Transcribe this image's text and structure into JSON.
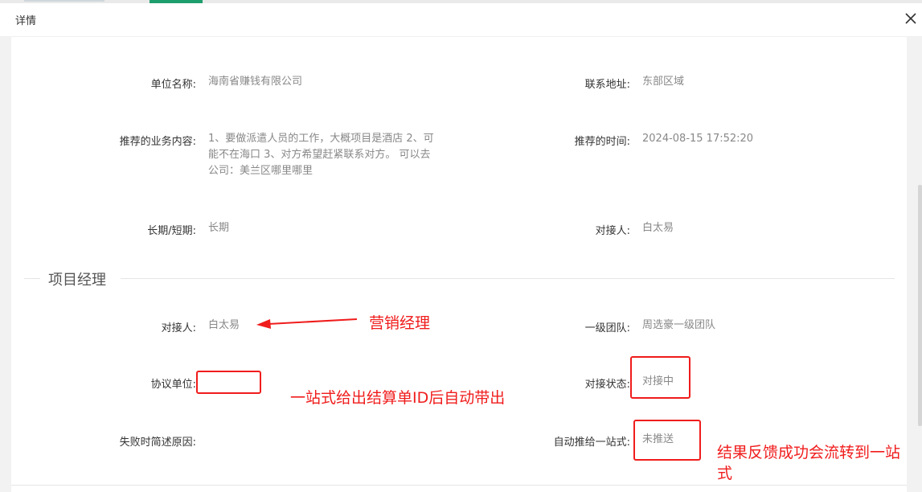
{
  "dialog": {
    "title": "详情"
  },
  "info": {
    "unit_label": "单位名称:",
    "unit_value": "海南省赚钱有限公司",
    "address_label": "联系地址:",
    "address_value": "东部区域",
    "business_label": "推荐的业务内容:",
    "business_value": "1、要做派遣人员的工作，大概项目是酒店 2、可能不在海口 3、对方希望赶紧联系对方。 可以去公司：美兰区哪里哪里",
    "time_label": "推荐的时间:",
    "time_value": "2024-08-15 17:52:20",
    "term_label": "长期/短期:",
    "term_value": "长期",
    "contact_label": "对接人:",
    "contact_value": "白太易"
  },
  "section": {
    "title": "项目经理"
  },
  "pm": {
    "contact_label": "对接人:",
    "contact_value": "白太易",
    "team_label": "一级团队:",
    "team_value": "周选豪一级团队",
    "agreement_label": "协议单位:",
    "agreement_value": "",
    "status_label": "对接状态:",
    "status_value": "对接中",
    "fail_label": "失败时简述原因:",
    "fail_value": "",
    "push_label": "自动推给一站式:",
    "push_value": "未推送"
  },
  "annotations": {
    "marketing": "营销经理",
    "onestop": "一站式给出结算单ID后自动带出",
    "feedback": "结果反馈成功会流转到一站式"
  },
  "colors": {
    "annotation": "#f01c1c",
    "accent": "#1f9e6d"
  },
  "icons": {
    "close": "close-icon",
    "arrow": "arrow-left-icon"
  }
}
